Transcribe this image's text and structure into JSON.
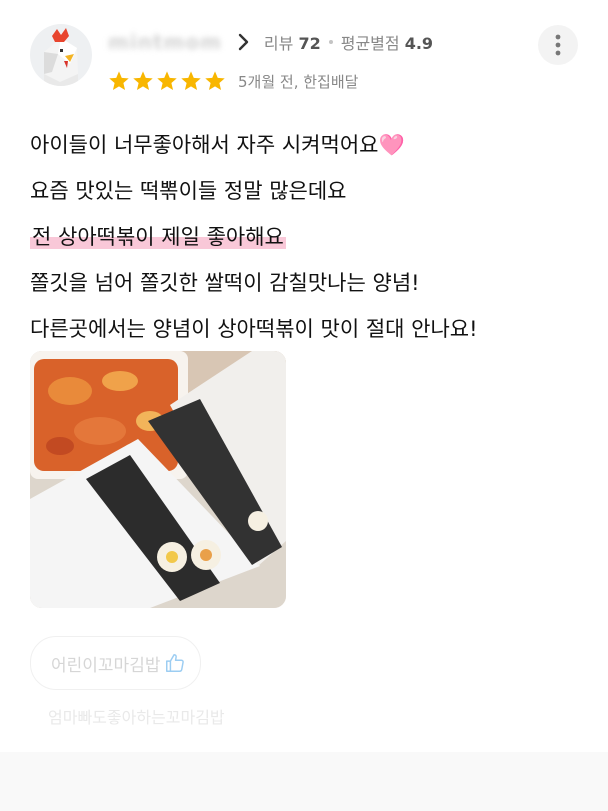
{
  "review": {
    "nickname": "mintmom",
    "review_count_label": "리뷰",
    "review_count": "72",
    "avg_rating_label": "평균별점",
    "avg_rating": "4.9",
    "star_rating": 5,
    "time_ago": "5개월 전, 한집배달",
    "text_lines": [
      "아이들이 너무좋아해서 자주 시켜먹어요",
      "요즘 맛있는 떡뽂이들 정말 많은데요",
      "전 상아떡볶이 제일 좋아해요",
      "쫄깃을 넘어 쫄깃한 쌀떡이 감칠맛나는 양념!",
      "다른곳에서는 양념이 상아떡볶이 맛이 절대 안나요!"
    ],
    "heart_emoji": "🩷",
    "ordered_menu": "어린이꼬마김밥",
    "menu_description": "엄마빠도좋아하는꼬마김밥"
  },
  "icons": {
    "avatar": "chicken-avatar-icon",
    "chevron": "chevron-right-icon",
    "more": "more-vertical-icon",
    "star": "star-icon",
    "thumb": "thumbs-up-icon"
  },
  "colors": {
    "star": "#f8b600",
    "highlight": "#f9c8d8",
    "muted_text": "#888888"
  }
}
